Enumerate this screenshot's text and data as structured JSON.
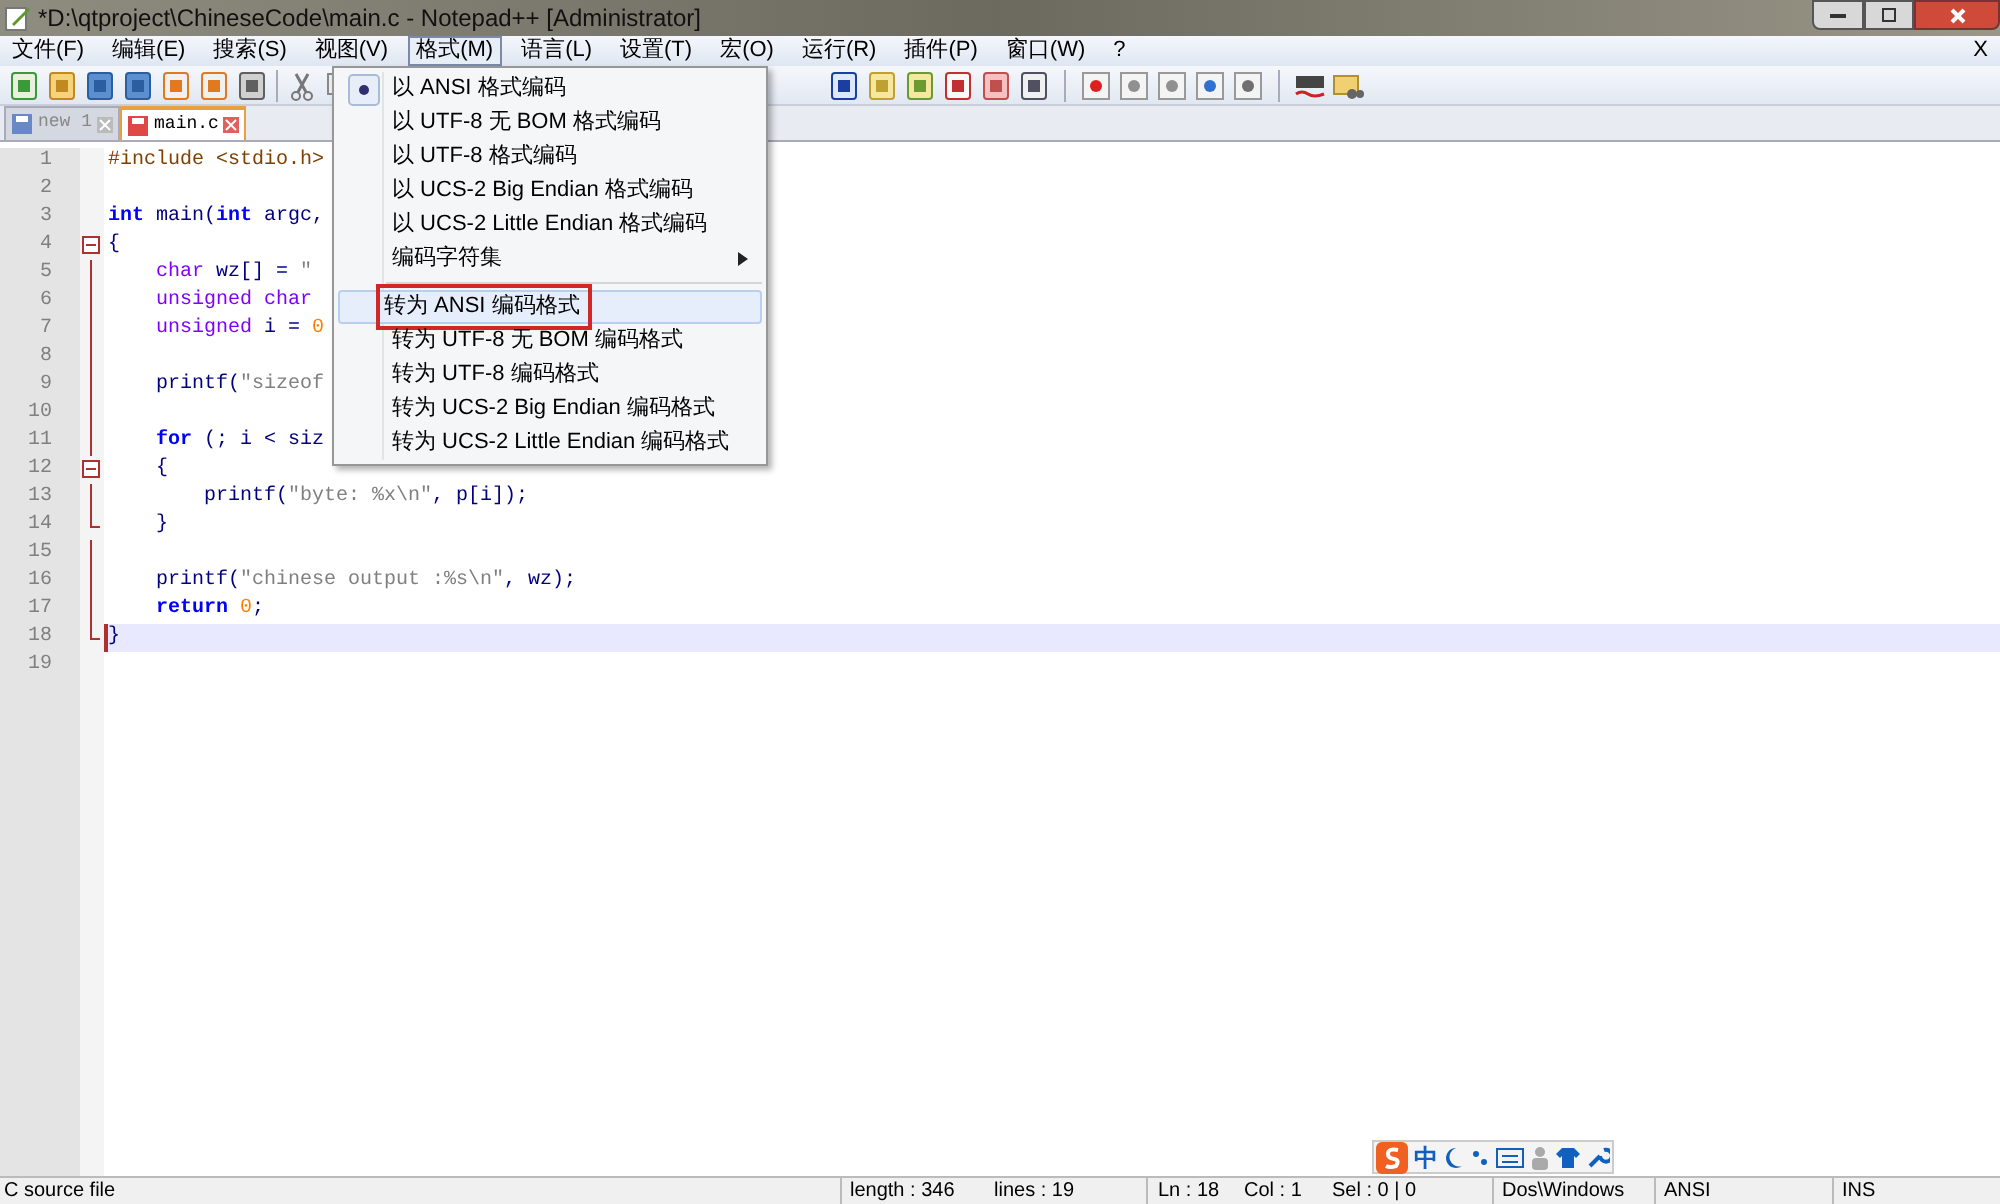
{
  "window": {
    "title": "*D:\\qtproject\\ChineseCode\\main.c - Notepad++ [Administrator]"
  },
  "menu_bar": {
    "items": [
      {
        "label": "文件(F)",
        "selected": false
      },
      {
        "label": "编辑(E)",
        "selected": false
      },
      {
        "label": "搜索(S)",
        "selected": false
      },
      {
        "label": "视图(V)",
        "selected": false
      },
      {
        "label": "格式(M)",
        "selected": true
      },
      {
        "label": "语言(L)",
        "selected": false
      },
      {
        "label": "设置(T)",
        "selected": false
      },
      {
        "label": "宏(O)",
        "selected": false
      },
      {
        "label": "运行(R)",
        "selected": false
      },
      {
        "label": "插件(P)",
        "selected": false
      },
      {
        "label": "窗口(W)",
        "selected": false
      },
      {
        "label": "?",
        "selected": false
      }
    ],
    "close": "X"
  },
  "tabs": [
    {
      "label": "new 1",
      "selected": false,
      "modified": false
    },
    {
      "label": "main.c",
      "selected": true,
      "modified": true
    }
  ],
  "editor": {
    "lines": [
      {
        "number": "1",
        "kind": "plain",
        "current": false,
        "segments": [
          {
            "kind": "preprocessor",
            "text": "#include <stdio.h>"
          }
        ]
      },
      {
        "number": "2",
        "kind": "plain",
        "current": false
      },
      {
        "number": "3",
        "kind": "plain",
        "current": false,
        "segments": [
          {
            "kind": "keyword",
            "text": "int"
          },
          {
            "kind": "plain",
            "text": " main("
          },
          {
            "kind": "keyword",
            "text": "int"
          },
          {
            "kind": "plain",
            "text": " argc,"
          }
        ]
      },
      {
        "number": "4",
        "kind": "foldstart",
        "current": false,
        "segments": [
          {
            "kind": "plain",
            "text": "{"
          }
        ]
      },
      {
        "number": "5",
        "kind": "foldbody",
        "current": false,
        "segments": [
          {
            "kind": "type",
            "text": "    char"
          },
          {
            "kind": "plain",
            "text": " wz[] = "
          },
          {
            "kind": "string",
            "text": "\""
          }
        ]
      },
      {
        "number": "6",
        "kind": "foldbody",
        "current": false,
        "segments": [
          {
            "kind": "type",
            "text": "    unsigned char"
          }
        ]
      },
      {
        "number": "7",
        "kind": "foldbody",
        "current": false,
        "segments": [
          {
            "kind": "type",
            "text": "    unsigned"
          },
          {
            "kind": "plain",
            "text": " i = "
          },
          {
            "kind": "number",
            "text": "0"
          }
        ]
      },
      {
        "number": "8",
        "kind": "foldbody",
        "current": false
      },
      {
        "number": "9",
        "kind": "foldbody",
        "current": false,
        "segments": [
          {
            "kind": "plain",
            "text": "    printf("
          },
          {
            "kind": "string",
            "text": "\"sizeof"
          }
        ]
      },
      {
        "number": "10",
        "kind": "foldbody",
        "current": false
      },
      {
        "number": "11",
        "kind": "foldbody",
        "current": false,
        "segments": [
          {
            "kind": "keyword",
            "text": "    for"
          },
          {
            "kind": "plain",
            "text": " (; i < siz"
          }
        ]
      },
      {
        "number": "12",
        "kind": "foldstart",
        "current": false,
        "segments": [
          {
            "kind": "plain",
            "text": "    {"
          }
        ]
      },
      {
        "number": "13",
        "kind": "foldbody",
        "current": false,
        "segments": [
          {
            "kind": "plain",
            "text": "        printf("
          },
          {
            "kind": "string",
            "text": "\"byte: %x\\n\""
          },
          {
            "kind": "plain",
            "text": ", p[i]);"
          }
        ]
      },
      {
        "number": "14",
        "kind": "foldend",
        "current": false,
        "segments": [
          {
            "kind": "plain",
            "text": "    }"
          }
        ]
      },
      {
        "number": "15",
        "kind": "foldbody",
        "current": false
      },
      {
        "number": "16",
        "kind": "foldbody",
        "current": false,
        "segments": [
          {
            "kind": "plain",
            "text": "    printf("
          },
          {
            "kind": "string",
            "text": "\"chinese output :%s\\n\""
          },
          {
            "kind": "plain",
            "text": ", wz);"
          }
        ]
      },
      {
        "number": "17",
        "kind": "foldbody",
        "current": false,
        "segments": [
          {
            "kind": "keyword",
            "text": "    return"
          },
          {
            "kind": "number",
            "text": " 0"
          },
          {
            "kind": "plain",
            "text": ";"
          }
        ]
      },
      {
        "number": "18",
        "kind": "foldend",
        "current": true,
        "segments": [
          {
            "kind": "plain",
            "text": "}"
          }
        ]
      },
      {
        "number": "19",
        "kind": "plain",
        "current": false
      }
    ]
  },
  "dropdown_menu": {
    "items": [
      {
        "label": "以 ANSI 格式编码",
        "checked": true,
        "selected": false,
        "submenu": false,
        "outlined": false,
        "separator_before": false
      },
      {
        "label": "以 UTF-8 无 BOM 格式编码",
        "checked": false,
        "selected": false,
        "submenu": false,
        "outlined": false,
        "separator_before": false
      },
      {
        "label": "以 UTF-8 格式编码",
        "checked": false,
        "selected": false,
        "submenu": false,
        "outlined": false,
        "separator_before": false
      },
      {
        "label": "以 UCS-2 Big Endian 格式编码",
        "checked": false,
        "selected": false,
        "submenu": false,
        "outlined": false,
        "separator_before": false
      },
      {
        "label": "以 UCS-2 Little Endian 格式编码",
        "checked": false,
        "selected": false,
        "submenu": false,
        "outlined": false,
        "separator_before": false
      },
      {
        "label": "编码字符集",
        "checked": false,
        "selected": false,
        "submenu": true,
        "outlined": false,
        "separator_before": false
      },
      {
        "label": "转为 ANSI 编码格式",
        "checked": false,
        "selected": true,
        "submenu": false,
        "outlined": true,
        "separator_before": true
      },
      {
        "label": "转为 UTF-8 无 BOM 编码格式",
        "checked": false,
        "selected": false,
        "submenu": false,
        "outlined": false,
        "separator_before": false
      },
      {
        "label": "转为 UTF-8 编码格式",
        "checked": false,
        "selected": false,
        "submenu": false,
        "outlined": false,
        "separator_before": false
      },
      {
        "label": "转为 UCS-2 Big Endian 编码格式",
        "checked": false,
        "selected": false,
        "submenu": false,
        "outlined": false,
        "separator_before": false
      },
      {
        "label": "转为 UCS-2 Little Endian 编码格式",
        "checked": false,
        "selected": false,
        "submenu": false,
        "outlined": false,
        "separator_before": false
      }
    ]
  },
  "ime_toolbar": {
    "mode": "中"
  },
  "status_bar": {
    "file_type": "C source file",
    "length": "length : 346",
    "lines": "lines : 19",
    "line": "Ln : 18",
    "column": "Col : 1",
    "selection": "Sel : 0 | 0",
    "eol": "Dos\\Windows",
    "encoding": "ANSI",
    "mode": "INS"
  }
}
